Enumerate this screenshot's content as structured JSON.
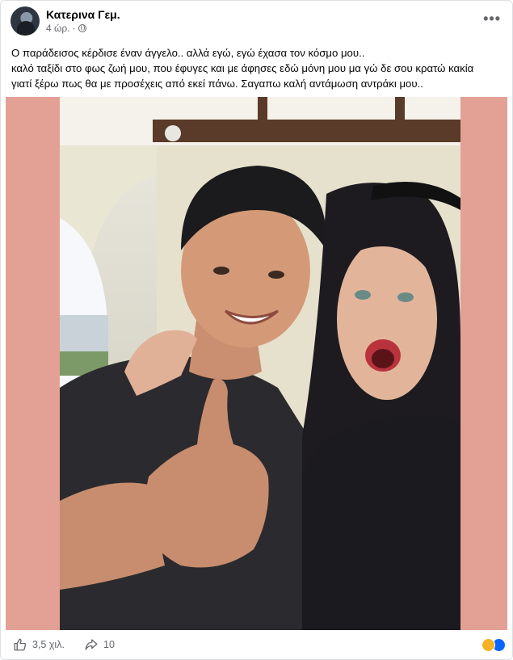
{
  "post": {
    "author": "Κατερινα Γεμ.",
    "time": "4 ώρ.",
    "separator": "·",
    "more_label": "•••",
    "caption_lines": [
      "Ο παράδεισος κέρδισε έναν άγγελο.. αλλά εγώ, εγώ έχασα τον κόσμο μου..",
      "καλό ταξίδι στο φως ζωή μου, που έφυγες και με άφησες εδώ μόνη μου μα γώ δε σου κρατώ κακία",
      "γιατί ξέρω πως θα με προσέχεις από εκεί πάνω. Σαγαπω καλή αντάμωση αντράκι μου.."
    ]
  },
  "media": {
    "background_color": "#e3a195"
  },
  "footer": {
    "like_count": "3,5 χιλ.",
    "share_count": "10"
  },
  "icons": {
    "more": "more-options-icon",
    "globe": "globe-icon",
    "like": "thumbs-up-icon",
    "share": "share-arrow-icon",
    "reactions": [
      "care-reaction-icon",
      "like-reaction-icon"
    ]
  },
  "colors": {
    "text_primary": "#050505",
    "text_secondary": "#65676b",
    "like_blue": "#0866ff",
    "care_yellow": "#f7b125"
  }
}
